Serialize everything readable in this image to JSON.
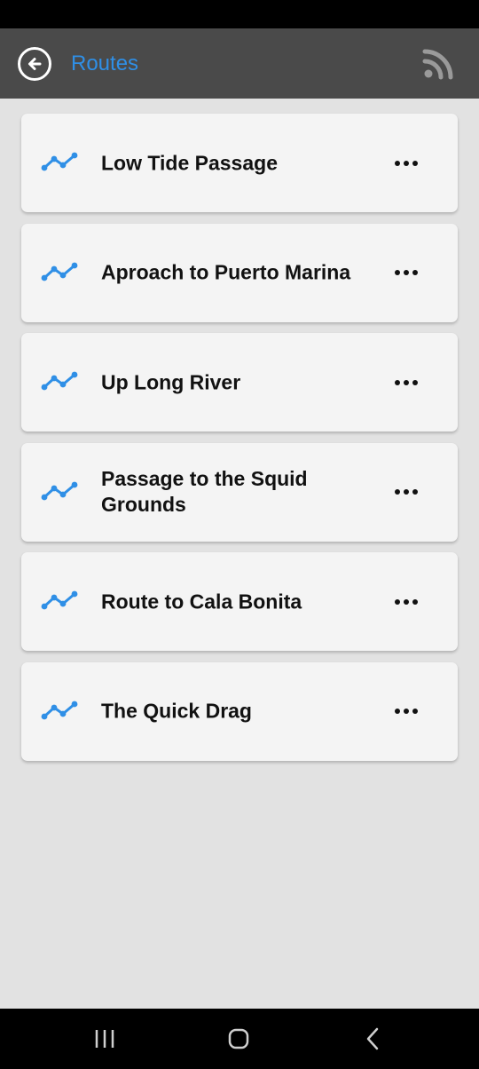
{
  "header": {
    "title": "Routes",
    "back_icon": "back-arrow-icon",
    "feed_icon": "rss-icon"
  },
  "colors": {
    "accent": "#2f8fe6",
    "app_bar": "#4a4a4a",
    "background": "#e2e2e2",
    "card": "#f4f4f4"
  },
  "routes": [
    {
      "name": "Low Tide Passage",
      "icon": "route-icon",
      "menu_icon": "more-horizontal-icon"
    },
    {
      "name": "Aproach to Puerto Marina",
      "icon": "route-icon",
      "menu_icon": "more-horizontal-icon"
    },
    {
      "name": "Up Long River",
      "icon": "route-icon",
      "menu_icon": "more-horizontal-icon"
    },
    {
      "name": "Passage to the Squid Grounds",
      "icon": "route-icon",
      "menu_icon": "more-horizontal-icon"
    },
    {
      "name": "Route to Cala Bonita",
      "icon": "route-icon",
      "menu_icon": "more-horizontal-icon"
    },
    {
      "name": "The Quick Drag",
      "icon": "route-icon",
      "menu_icon": "more-horizontal-icon"
    }
  ],
  "system_nav": {
    "recents_icon": "recents-icon",
    "home_icon": "home-icon",
    "back_icon": "system-back-icon"
  }
}
